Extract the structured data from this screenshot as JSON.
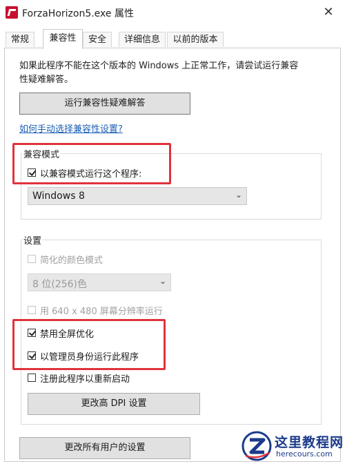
{
  "window": {
    "title": "ForzaHorizon5.exe 属性",
    "close_glyph": "✕"
  },
  "tabs": [
    {
      "label": "常规"
    },
    {
      "label": "兼容性"
    },
    {
      "label": "安全"
    },
    {
      "label": "详细信息"
    },
    {
      "label": "以前的版本"
    }
  ],
  "active_tab": "兼容性",
  "intro": {
    "line1": "如果此程序不能在这个版本的 Windows 上正常工作，请尝试运行兼容",
    "line2": "性疑难解答。"
  },
  "troubleshooter_button": "运行兼容性疑难解答",
  "manual_link": "如何手动选择兼容性设置?",
  "compat_mode": {
    "group_label": "兼容模式",
    "checkbox_label": "以兼容模式运行这个程序:",
    "checked": true,
    "os_value": "Windows 8",
    "chevron_glyph": "⌄"
  },
  "settings": {
    "group_label": "设置",
    "reduced_color": {
      "label": "简化的颜色模式",
      "checked": false,
      "enabled": false
    },
    "color_depth": {
      "value": "8 位(256)色",
      "enabled": false
    },
    "low_res": {
      "label": "用 640 x 480 屏幕分辨率运行",
      "checked": false,
      "enabled": false
    },
    "disable_fullscreen_opt": {
      "label": "禁用全屏优化",
      "checked": true
    },
    "run_as_admin": {
      "label": "以管理员身份运行此程序",
      "checked": true
    },
    "register_restart": {
      "label": "注册此程序以重新启动",
      "checked": false
    },
    "dpi_button": "更改高 DPI 设置"
  },
  "all_users_button": "更改所有用户的设置",
  "highlight_color": "#e0323c",
  "watermark": {
    "title": "这里教程网",
    "subtitle": "herecours.com",
    "logo": "z-circle-logo"
  }
}
